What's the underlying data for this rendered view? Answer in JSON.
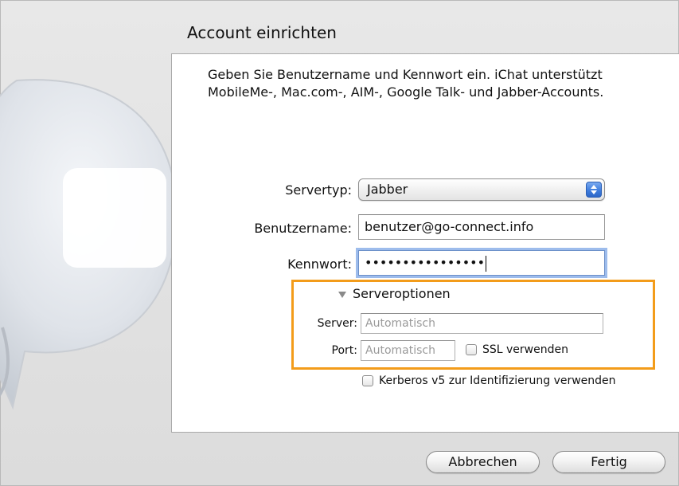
{
  "dialog": {
    "title": "Account einrichten",
    "intro": "Geben Sie Benutzername und Kennwort ein. iChat unterstützt MobileMe-, Mac.com-, AIM-, Google Talk- und Jabber-Accounts."
  },
  "form": {
    "servertype_label": "Servertyp:",
    "servertype_value": "Jabber",
    "username_label": "Benutzername:",
    "username_value": "benutzer@go-connect.info",
    "password_label": "Kennwort:",
    "password_value": "••••••••••••••••"
  },
  "server_options": {
    "toggle_label": "Serveroptionen",
    "server_label": "Server:",
    "server_placeholder": "Automatisch",
    "port_label": "Port:",
    "port_placeholder": "Automatisch",
    "ssl_label": "SSL verwenden"
  },
  "kerberos_label": "Kerberos v5 zur Identifizierung verwenden",
  "buttons": {
    "cancel": "Abbrechen",
    "done": "Fertig"
  },
  "colors": {
    "highlight_box": "#f39c1a",
    "popup_arrow": "#3f7ddd",
    "focus_ring": "#9dbcec"
  }
}
